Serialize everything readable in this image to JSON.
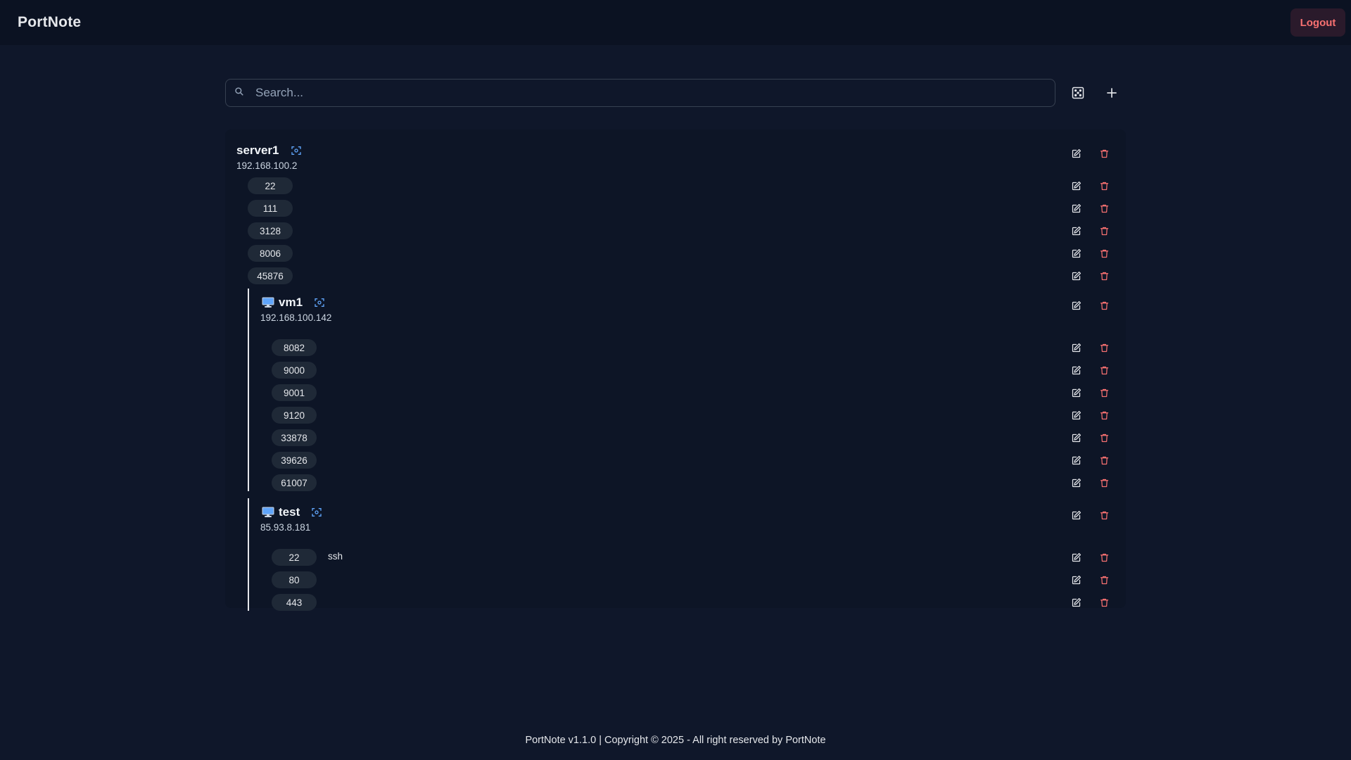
{
  "header": {
    "brand": "PortNote",
    "logout_label": "Logout",
    "logout_color": "#f87171"
  },
  "search": {
    "placeholder": "Search..."
  },
  "toolbar": {
    "random_icon": "dice-icon",
    "add_icon": "plus-icon"
  },
  "server": {
    "name": "server1",
    "ip": "192.168.100.2",
    "ports": [
      {
        "port": "22",
        "note": ""
      },
      {
        "port": "111",
        "note": ""
      },
      {
        "port": "3128",
        "note": ""
      },
      {
        "port": "8006",
        "note": ""
      },
      {
        "port": "45876",
        "note": ""
      }
    ],
    "vms": [
      {
        "name": "vm1",
        "ip": "192.168.100.142",
        "ports": [
          {
            "port": "8082",
            "note": ""
          },
          {
            "port": "9000",
            "note": ""
          },
          {
            "port": "9001",
            "note": ""
          },
          {
            "port": "9120",
            "note": ""
          },
          {
            "port": "33878",
            "note": ""
          },
          {
            "port": "39626",
            "note": ""
          },
          {
            "port": "61007",
            "note": ""
          }
        ]
      },
      {
        "name": "test",
        "ip": "85.93.8.181",
        "ports": [
          {
            "port": "22",
            "note": "ssh"
          },
          {
            "port": "80",
            "note": ""
          },
          {
            "port": "443",
            "note": ""
          }
        ]
      }
    ]
  },
  "footer": {
    "text": "PortNote v1.1.0 | Copyright © 2025 - All right reserved by PortNote"
  },
  "colors": {
    "background": "#0f172a",
    "delete": "#f87171",
    "scan": "#60a5fa",
    "pill": "#1f2937"
  }
}
